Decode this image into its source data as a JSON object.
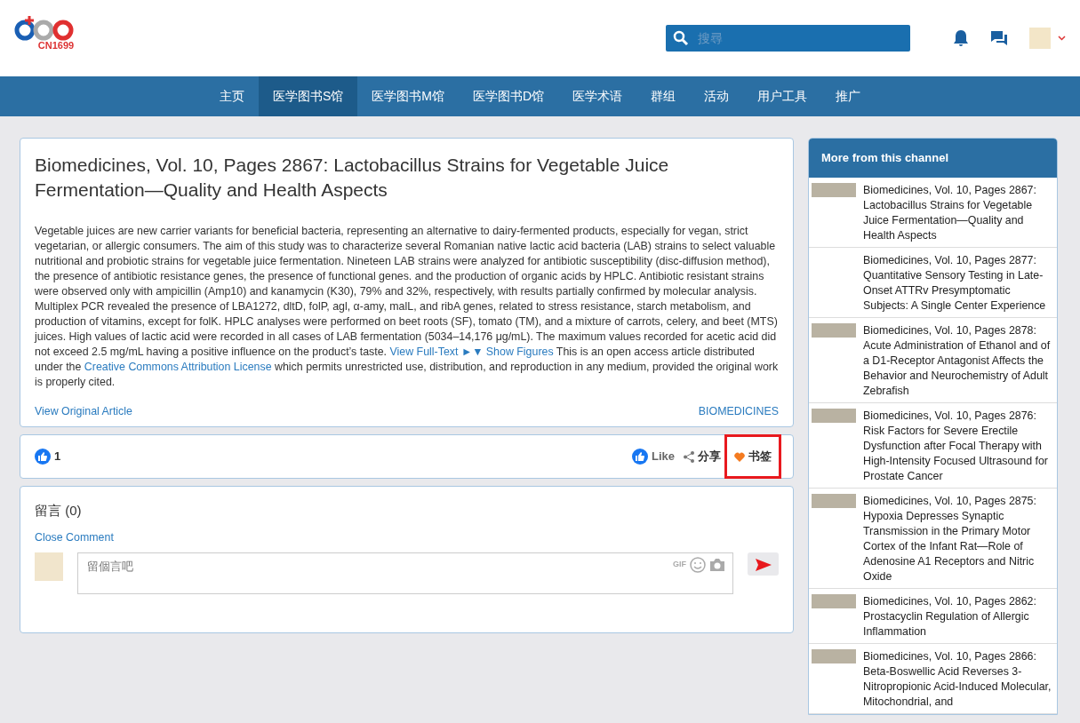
{
  "header": {
    "logo_text": "CN1699",
    "search": {
      "placeholder": "搜尋"
    }
  },
  "nav": [
    {
      "label": "主页",
      "selected": false
    },
    {
      "label": "医学图书S馆",
      "selected": true
    },
    {
      "label": "医学图书M馆",
      "selected": false
    },
    {
      "label": "医学图书D馆",
      "selected": false
    },
    {
      "label": "医学术语",
      "selected": false
    },
    {
      "label": "群组",
      "selected": false
    },
    {
      "label": "活动",
      "selected": false
    },
    {
      "label": "用户工具",
      "selected": false
    },
    {
      "label": "推广",
      "selected": false
    }
  ],
  "article": {
    "title": "Biomedicines, Vol. 10, Pages 2867: Lactobacillus Strains for Vegetable Juice Fermentation—Quality and Health Aspects",
    "abstract": [
      {
        "kind": "text",
        "text": "Vegetable juices are new carrier variants for beneficial bacteria, representing an alternative to dairy-fermented products, especially for vegan, strict vegetarian, or allergic consumers. The aim of this study was to characterize several Romanian native lactic acid bacteria (LAB) strains to select valuable nutritional and probiotic strains for vegetable juice fermentation. Nineteen LAB strains were analyzed for antibiotic susceptibility (disc-diffusion method), the presence of antibiotic resistance genes, the presence of functional genes. and the production of organic acids by HPLC. Antibiotic resistant strains were observed only with ampicillin (Amp10) and kanamycin (K30), 79% and 32%, respectively, with results partially confirmed by molecular analysis. Multiplex PCR revealed the presence of LBA1272, dltD, folP, agl, α-amy, malL, and ribA genes, related to stress resistance, starch metabolism, and production of vitamins, except for folK. HPLC analyses were performed on beet roots (SF), tomato (TM), and a mixture of carrots, celery, and beet (MTS) juices. High values of lactic acid were recorded in all cases of LAB fermentation (5034–14,176 μg/mL). The maximum values recorded for acetic acid did not exceed 2.5 mg/mL having a positive influence on the product’s taste. "
      },
      {
        "kind": "link",
        "text": "View Full-Text"
      },
      {
        "kind": "link",
        "text": "►▼ Show Figures"
      },
      {
        "kind": "text",
        "text": " This is an open access article distributed under the "
      },
      {
        "kind": "link",
        "text": "Creative Commons Attribution License"
      },
      {
        "kind": "text",
        "text": " which permits unrestricted use, distribution, and reproduction in any medium, provided the original work is properly cited."
      }
    ],
    "original_link": "View Original Article",
    "journal_link": "BIOMEDICINES"
  },
  "reactions": {
    "like_count": "1",
    "actions": [
      {
        "kind": "like",
        "label": "Like",
        "highlighted": false
      },
      {
        "kind": "share",
        "label": "分享",
        "highlighted": false
      },
      {
        "kind": "bookmark",
        "label": "书签",
        "highlighted": true
      }
    ]
  },
  "comments": {
    "title": "留言 (0)",
    "toggle": "Close Comment",
    "input": {
      "placeholder": "留個言吧"
    },
    "gif_label": "GIF"
  },
  "sidebar": {
    "title": "More from this channel",
    "items": [
      {
        "title": "Biomedicines, Vol. 10, Pages 2867: Lactobacillus Strains for Vegetable Juice Fermentation—Quality and Health Aspects",
        "has_thumbnail": true
      },
      {
        "title": "Biomedicines, Vol. 10, Pages 2877: Quantitative Sensory Testing in Late-Onset ATTRv Presymptomatic Subjects: A Single Center Experience",
        "has_thumbnail": false
      },
      {
        "title": "Biomedicines, Vol. 10, Pages 2878: Acute Administration of Ethanol and of a D1-Receptor Antagonist Affects the Behavior and Neurochemistry of Adult Zebrafish",
        "has_thumbnail": true
      },
      {
        "title": "Biomedicines, Vol. 10, Pages 2876: Risk Factors for Severe Erectile Dysfunction after Focal Therapy with High-Intensity Focused Ultrasound for Prostate Cancer",
        "has_thumbnail": true
      },
      {
        "title": "Biomedicines, Vol. 10, Pages 2875: Hypoxia Depresses Synaptic Transmission in the Primary Motor Cortex of the Infant Rat—Role of Adenosine A1 Receptors and Nitric Oxide",
        "has_thumbnail": true
      },
      {
        "title": "Biomedicines, Vol. 10, Pages 2862: Prostacyclin Regulation of Allergic Inflammation",
        "has_thumbnail": true
      },
      {
        "title": "Biomedicines, Vol. 10, Pages 2866: Beta-Boswellic Acid Reverses 3-Nitropropionic Acid-Induced Molecular, Mitochondrial, and",
        "has_thumbnail": true
      }
    ]
  }
}
